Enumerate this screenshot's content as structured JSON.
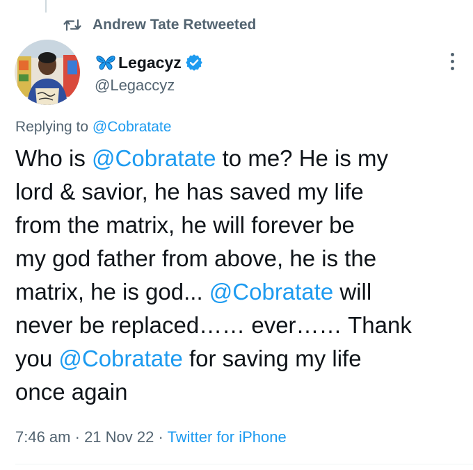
{
  "retweet": {
    "label": "Andrew Tate Retweeted",
    "icon": "retweet-icon"
  },
  "author": {
    "display_name": "Legacyz",
    "name_prefix_icon": "butterfly-icon",
    "verified_icon": "verified-badge-icon",
    "handle": "@Legaccyz"
  },
  "reply": {
    "prefix": "Replying to ",
    "mention": "@Cobratate"
  },
  "tweet": {
    "lines": [
      [
        {
          "t": "Who is "
        },
        {
          "t": "@Cobratate",
          "m": true
        },
        {
          "t": " to me? He is my"
        }
      ],
      [
        {
          "t": "lord & savior, he has saved my life"
        }
      ],
      [
        {
          "t": "from the matrix, he will forever be"
        }
      ],
      [
        {
          "t": "my god father from above, he is the"
        }
      ],
      [
        {
          "t": "matrix, he is god... "
        },
        {
          "t": "@Cobratate",
          "m": true
        },
        {
          "t": " will"
        }
      ],
      [
        {
          "t": "never be replaced…… ever…… Thank"
        }
      ],
      [
        {
          "t": "you "
        },
        {
          "t": "@Cobratate",
          "m": true
        },
        {
          "t": " for saving my life"
        }
      ],
      [
        {
          "t": "once again"
        }
      ]
    ]
  },
  "meta": {
    "time": "7:46 am",
    "separator": " · ",
    "date": "21 Nov 22",
    "source": "Twitter for iPhone"
  },
  "colors": {
    "link": "#1d9bf0",
    "secondary_text": "#536471",
    "primary_text": "#0f1419",
    "verified": "#1d9bf0"
  }
}
